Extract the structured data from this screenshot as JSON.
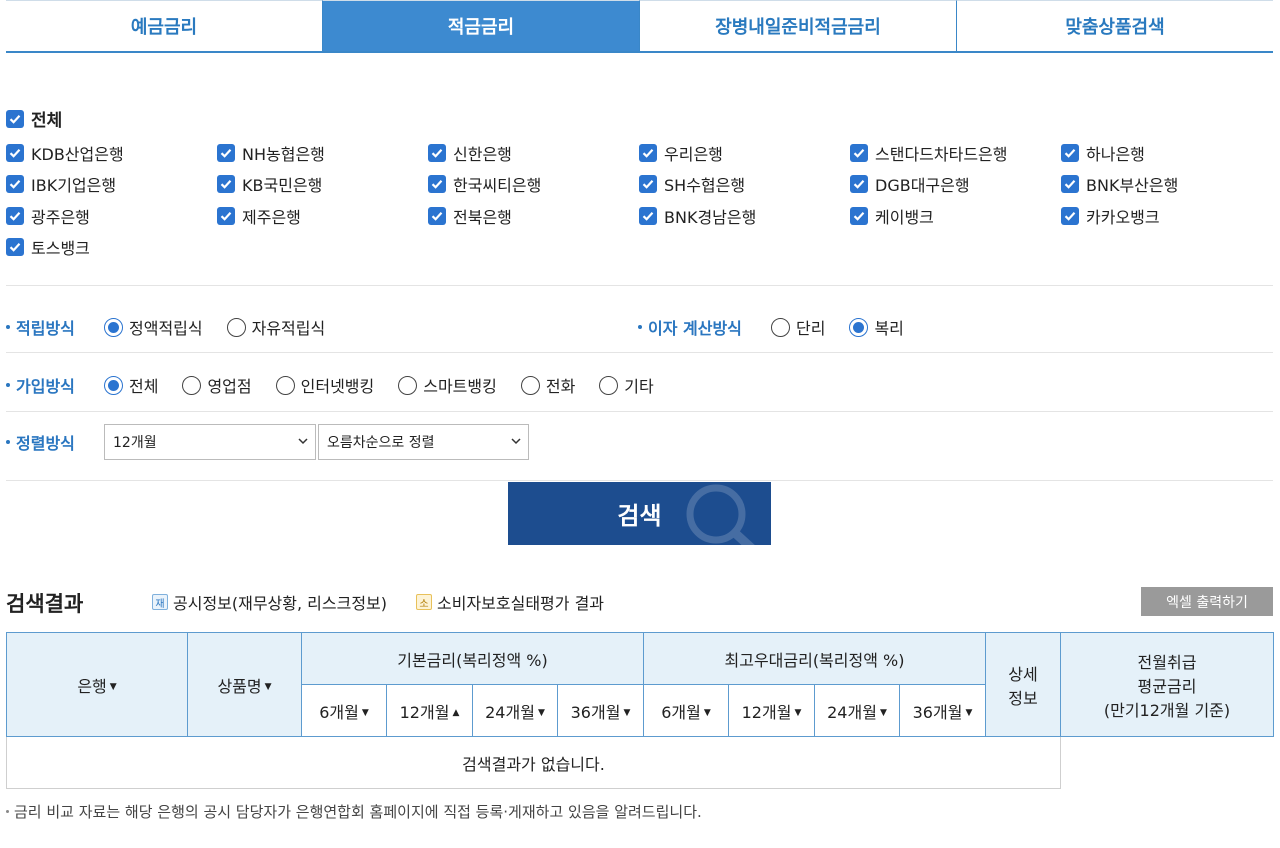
{
  "tabs": [
    "예금금리",
    "적금금리",
    "장병내일준비적금금리",
    "맞춤상품검색"
  ],
  "select_all_label": "전체",
  "banks": [
    [
      "KDB산업은행",
      "NH농협은행",
      "신한은행",
      "우리은행",
      "스탠다드차타드은행",
      "하나은행"
    ],
    [
      "IBK기업은행",
      "KB국민은행",
      "한국씨티은행",
      "SH수협은행",
      "DGB대구은행",
      "BNK부산은행"
    ],
    [
      "광주은행",
      "제주은행",
      "전북은행",
      "BNK경남은행",
      "케이뱅크",
      "카카오뱅크"
    ],
    [
      "토스뱅크"
    ]
  ],
  "saving_method": {
    "label": "적립방식",
    "options": [
      "정액적립식",
      "자유적립식"
    ],
    "selected": "정액적립식"
  },
  "interest_method": {
    "label": "이자 계산방식",
    "options": [
      "단리",
      "복리"
    ],
    "selected": "복리"
  },
  "join_method": {
    "label": "가입방식",
    "options": [
      "전체",
      "영업점",
      "인터넷뱅킹",
      "스마트뱅킹",
      "전화",
      "기타"
    ],
    "selected": "전체"
  },
  "sort_method": {
    "label": "정렬방식",
    "period": "12개월",
    "order": "오름차순으로 정렬"
  },
  "search_button": "검색",
  "results": {
    "title": "검색결과",
    "legend_disclosure_tag": "재",
    "legend_disclosure": "공시정보(재무상황, 리스크정보)",
    "legend_consumer_tag": "소",
    "legend_consumer": "소비자보호실태평가 결과",
    "excel_button": "엑셀 출력하기",
    "col_bank": "은행",
    "col_product": "상품명",
    "col_base_rate": "기본금리(복리정액 %)",
    "col_max_rate": "최고우대금리(복리정액 %)",
    "col_detail_1": "상세",
    "col_detail_2": "정보",
    "col_avg_1": "전월취급",
    "col_avg_2": "평균금리",
    "col_avg_3": "(만기12개월 기준)",
    "periods": [
      "6개월",
      "12개월",
      "24개월",
      "36개월"
    ],
    "empty_message": "검색결과가 없습니다."
  },
  "footnote": "금리 비교 자료는 해당 은행의 공시 담당자가 은행연합회 홈페이지에 직접 등록·게재하고 있음을 알려드립니다.",
  "colors": {
    "accent": "#3d8ad0",
    "search_button": "#1d4d8f",
    "checkbox": "#2b74d0"
  }
}
